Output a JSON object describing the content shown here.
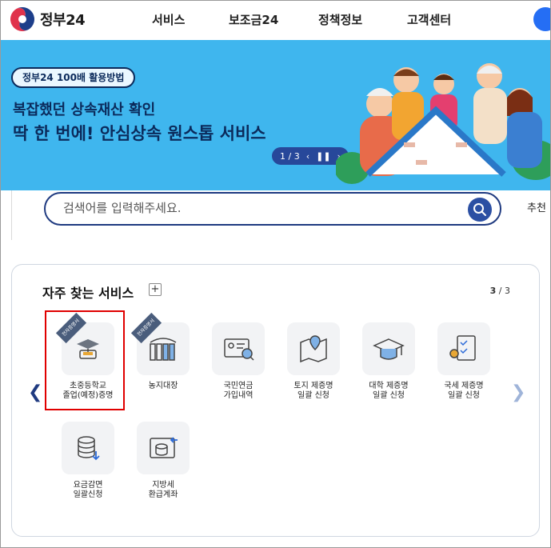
{
  "header": {
    "logo_text": "정부24",
    "nav": [
      "서비스",
      "보조금24",
      "정책정보",
      "고객센터"
    ]
  },
  "banner": {
    "pill": "정부24 100배 활용방법",
    "title1": "복잡했던 상속재산 확인",
    "title2": "딱 한 번에! 안심상속 원스톱 서비스",
    "pager": "1 / 3",
    "prev_icon": "chevron-left-icon",
    "pause_icon": "pause-icon",
    "next_icon": "chevron-right-icon"
  },
  "search": {
    "placeholder": "검색어를 입력해주세요.",
    "recommend_label": "추천"
  },
  "services": {
    "title": "자주 찾는 서비스",
    "plus": "+",
    "page_current": "3",
    "page_total": "/ 3",
    "items": [
      {
        "label_1": "초중등학교",
        "label_2": "졸업(예정)증명",
        "badge": "전자증명서"
      },
      {
        "label_1": "농지대장",
        "label_2": "",
        "badge": "전자증명서"
      },
      {
        "label_1": "국민연금",
        "label_2": "가입내역",
        "badge": ""
      },
      {
        "label_1": "토지 제증명",
        "label_2": "일괄 신청",
        "badge": ""
      },
      {
        "label_1": "대학 제증명",
        "label_2": "일괄 신청",
        "badge": ""
      },
      {
        "label_1": "국세 제증명",
        "label_2": "일괄 신청",
        "badge": ""
      },
      {
        "label_1": "요금감면",
        "label_2": "일괄신청",
        "badge": ""
      },
      {
        "label_1": "지방세",
        "label_2": "환급계좌",
        "badge": ""
      }
    ]
  },
  "colors": {
    "banner_bg": "#3fb6ee",
    "navy": "#0b2a5b",
    "accent_blue": "#256ef4",
    "highlight_red": "#e00000"
  }
}
